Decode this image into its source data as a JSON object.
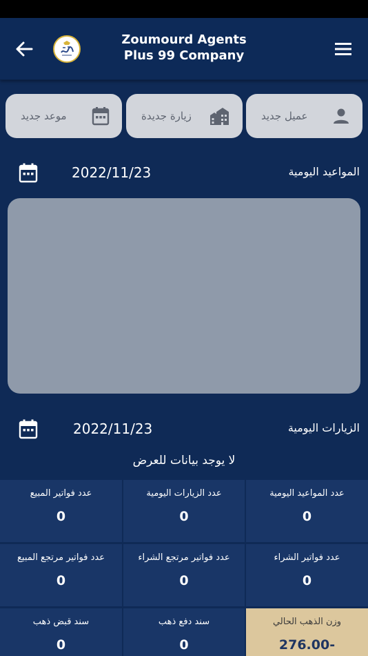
{
  "app_bar": {
    "title_line1": "Zoumourd Agents",
    "title_line2": "Plus 99 Company"
  },
  "quick_actions": {
    "new_client": "عميل جديد",
    "new_visit": "زيارة جديدة",
    "new_appointment": "موعد جديد"
  },
  "appointments": {
    "title": "المواعيد اليومية",
    "date": "2022/11/23"
  },
  "visits": {
    "title": "الزيارات اليومية",
    "date": "2022/11/23",
    "empty_message": "لا يوجد بيانات للعرض"
  },
  "stats": {
    "daily_appointments_label": "عدد المواعيد اليومية",
    "daily_appointments_value": "0",
    "daily_visits_label": "عدد الزيارات اليومية",
    "daily_visits_value": "0",
    "sales_invoices_label": "عدد فواتير المبيع",
    "sales_invoices_value": "0",
    "purchase_invoices_label": "عدد فواتير الشراء",
    "purchase_invoices_value": "0",
    "purchase_returns_label": "عدد فواتير مرتجع الشراء",
    "purchase_returns_value": "0",
    "sales_returns_label": "عدد فواتير مرتجع المبيع",
    "sales_returns_value": "0",
    "current_gold_weight_label": "وزن الذهب الحالي",
    "current_gold_weight_value": "276.00-",
    "gold_payment_label": "سند دفع ذهب",
    "gold_payment_value": "0",
    "gold_receipt_label": "سند قبض ذهب",
    "gold_receipt_value": "0"
  },
  "colors": {
    "background": "#0f2a56",
    "card": "#193667",
    "quick_button": "#d2d5db",
    "panel": "#8f9aaa",
    "gold_card": "#dcc79d",
    "logo_ring": "#d8b43a"
  }
}
